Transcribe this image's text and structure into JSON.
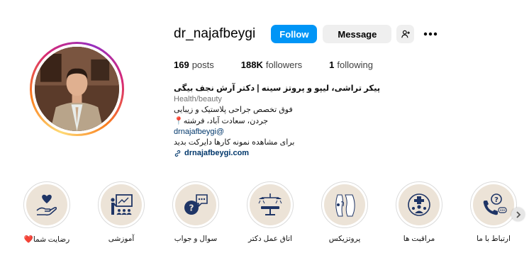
{
  "profile": {
    "username": "dr_najafbeygi",
    "follow_label": "Follow",
    "message_label": "Message",
    "suggest_icon": "person-add-icon",
    "more_icon": "more-dots-icon",
    "avatar_alt": "profile-photo"
  },
  "stats": {
    "posts_count": "169",
    "posts_label": "posts",
    "followers_count": "188K",
    "followers_label": "followers",
    "following_count": "1",
    "following_label": "following"
  },
  "bio": {
    "name": "پیکر تراشی، لیپو و پروتز سینه | دکتر آرش نجف بیگی",
    "category": "Health/beauty",
    "line1": "فوق تخصص جراحی پلاستیک و زیبایی",
    "line2": "جردن، سعادت آباد، فرشته📍",
    "handle": "drnajafbeygi@",
    "line3": "برای مشاهده نمونه کارها دایرکت بدید",
    "website": "drnajafbeygi.com"
  },
  "highlights": [
    {
      "label": "رضایت شما❤️",
      "icon": "heart-hand-icon"
    },
    {
      "label": "آموزشی",
      "icon": "teaching-board-icon"
    },
    {
      "label": "سوال و جواب",
      "icon": "question-chat-icon"
    },
    {
      "label": "اتاق عمل دکتر",
      "icon": "surgery-lamp-icon"
    },
    {
      "label": "پروتزیکس",
      "icon": "body-contour-icon"
    },
    {
      "label": "مراقبت ها",
      "icon": "medical-care-icon"
    },
    {
      "label": "ارتباط با ما",
      "icon": "contact-phone-icon"
    }
  ],
  "colors": {
    "follow_button": "#0095f6",
    "secondary_button": "#efefef",
    "highlight_bg": "#ece3d7",
    "highlight_ink": "#1f3566",
    "link": "#00376b"
  }
}
